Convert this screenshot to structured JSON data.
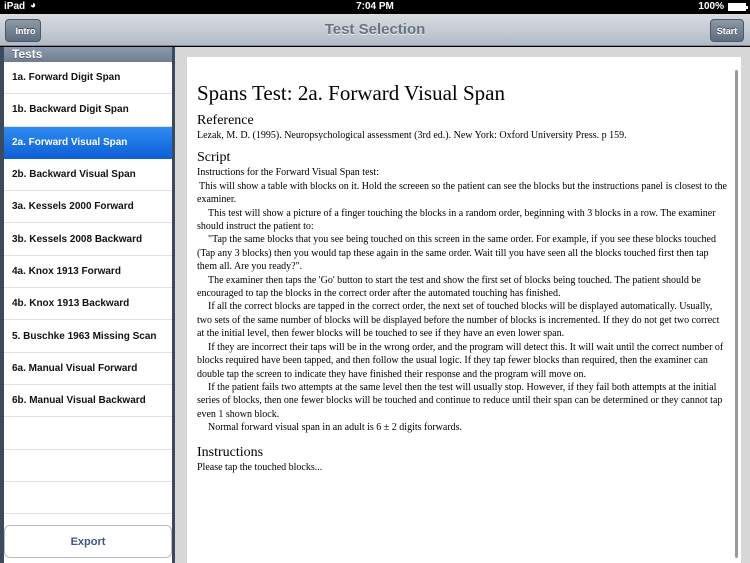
{
  "status_bar": {
    "carrier": "iPad",
    "wifi_icon": "wifi-icon",
    "time": "7:04 PM",
    "battery_percent": "100%",
    "battery_icon": "battery-icon"
  },
  "nav_bar": {
    "title": "Test Selection",
    "back_label": "Intro",
    "start_label": "Start"
  },
  "sidebar": {
    "header": "Tests",
    "items": [
      {
        "label": "1a. Forward Digit Span"
      },
      {
        "label": "1b. Backward Digit Span"
      },
      {
        "label": "2a. Forward Visual Span",
        "selected": true
      },
      {
        "label": "2b. Backward Visual Span"
      },
      {
        "label": "3a. Kessels 2000 Forward"
      },
      {
        "label": "3b. Kessels 2008 Backward"
      },
      {
        "label": "4a. Knox 1913 Forward"
      },
      {
        "label": "4b. Knox 1913 Backward"
      },
      {
        "label": "5. Buschke 1963 Missing Scan"
      },
      {
        "label": "6a. Manual Visual Forward"
      },
      {
        "label": "6b. Manual Visual Backward"
      }
    ],
    "export_label": "Export"
  },
  "content": {
    "title": "Spans Test: 2a. Forward Visual Span",
    "reference_heading": "Reference",
    "reference_text": "Lezak, M. D. (1995). Neuropsychological assessment (3rd ed.). New York: Oxford University Press. p 159.",
    "script_heading": "Script",
    "script_paragraphs": [
      "Instructions for the Forward Visual Span test:",
      "This will show a table with blocks on it. Hold the screeen so the patient can see the blocks but the instructions panel is closest to the examiner.",
      "This test will show a picture of a finger touching the blocks in a random order, beginning with 3 blocks in a row. The examiner should instruct the patient to:",
      "\"Tap the same blocks that you see being touched on this screen in the same order. For example, if you see these blocks touched (Tap any 3 blocks) then you would tap these again in the same order. Wait till you have seen all the blocks touched first then tap them all. Are you ready?\".",
      "The examiner then taps the 'Go' button to start the test and show the first set of blocks being touched. The patient should be encouraged to tap the blocks in the correct order after the automated touching has finished.",
      "If all the correct blocks are tapped in the correct order, the next set of touched blocks will be displayed automatically. Usually, two sets of the same number of blocks will be displayed before the number of blocks is incremented. If they do not get two correct at the initial level, then fewer blocks will be touched to see if they have an even lower span.",
      "If they are incorrect their taps will be in the wrong order, and the program will detect this. It will wait until the correct number of blocks required have been tapped, and then follow the usual logic. If they tap fewer blocks than required, then the examiner can double tap the screen to indicate they have finished their response and the program will move on.",
      "If the patient fails two attempts at the same level then the test will usually stop. However, if they fail both attempts at the initial series of blocks, then one fewer blocks will be touched and continue to reduce until their span can be determined or they cannot tap even 1 shown block.",
      "Normal forward visual span in an adult is 6 ± 2 digits forwards."
    ],
    "instructions_heading": "Instructions",
    "instructions_text": "Please tap the touched blocks..."
  }
}
